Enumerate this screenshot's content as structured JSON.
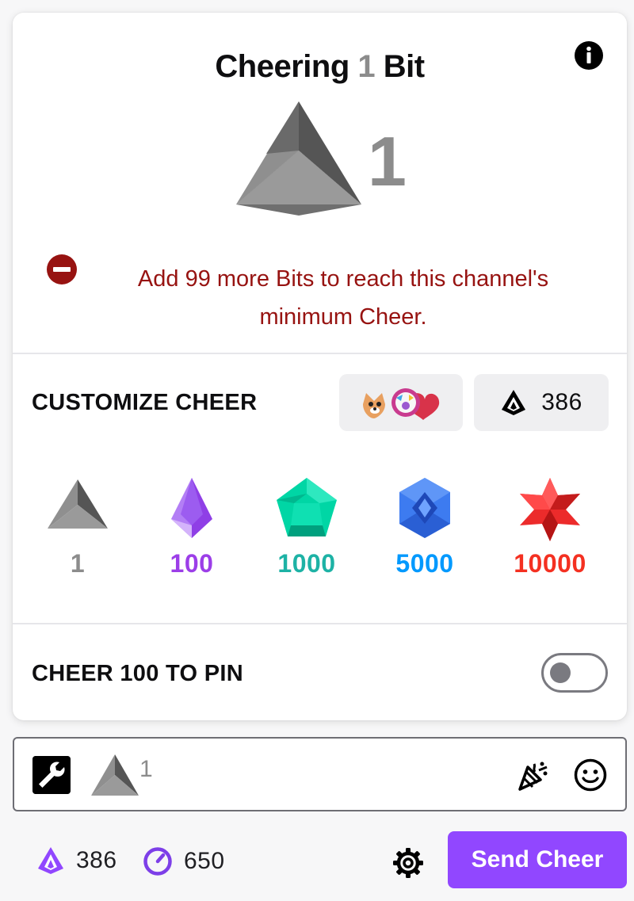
{
  "header": {
    "title_prefix": "Cheering",
    "title_amount": "1",
    "title_suffix": "Bit",
    "info_icon": "info-icon"
  },
  "preview": {
    "amount": "1",
    "gem_icon": "bits-gray-gem-icon"
  },
  "warning": {
    "icon": "minus-circle-icon",
    "text": "Add 99 more Bits to reach this channel's minimum Cheer.",
    "color": "#971311"
  },
  "customize": {
    "label": "CUSTOMIZE CHEER",
    "emotes_icon": "cheer-emotes-icon",
    "balance": "386",
    "balance_icon": "bits-icon"
  },
  "tiers": [
    {
      "amount": "1",
      "color": "#8c8c8c",
      "icon": "gray-triangle-gem-icon"
    },
    {
      "amount": "100",
      "color": "#9c3ee8",
      "icon": "purple-gem-icon"
    },
    {
      "amount": "1000",
      "color": "#1db2a5",
      "icon": "teal-gem-icon"
    },
    {
      "amount": "5000",
      "color": "#0099fe",
      "icon": "blue-gem-icon"
    },
    {
      "amount": "10000",
      "color": "#f43021",
      "icon": "red-star-gem-icon"
    }
  ],
  "pin": {
    "label": "CHEER 100 TO PIN",
    "toggle_on": false
  },
  "input": {
    "value": "1",
    "wrench_icon": "wrench-icon",
    "confetti_icon": "confetti-icon",
    "emoji_icon": "smiley-icon"
  },
  "footer": {
    "bits_balance": "386",
    "channel_points": "650",
    "settings_icon": "gear-icon",
    "send_label": "Send Cheer",
    "accent": "#9147ff"
  }
}
